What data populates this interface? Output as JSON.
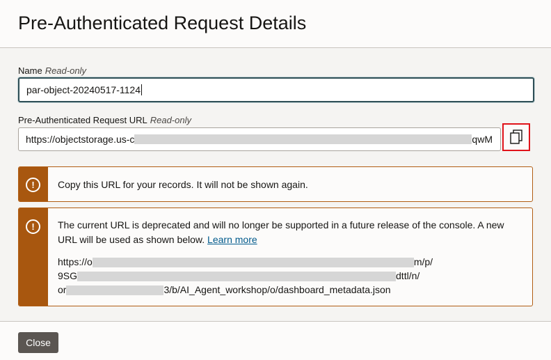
{
  "dialog": {
    "title": "Pre-Authenticated Request Details"
  },
  "name_field": {
    "label": "Name",
    "readonly_tag": "Read-only",
    "value": "par-object-20240517-1124"
  },
  "url_field": {
    "label": "Pre-Authenticated Request URL",
    "readonly_tag": "Read-only",
    "value_visible_start": "https://objectstorage.us-c",
    "value_visible_end": "qwM"
  },
  "copy_button": {
    "icon": "copy-icon"
  },
  "notice_copy": {
    "icon": "info-icon",
    "text": "Copy this URL for your records. It will not be shown again."
  },
  "notice_deprecated": {
    "icon": "info-icon",
    "text": "The current URL is deprecated and will no longer be supported in a future release of the console. A new URL will be used as shown below.",
    "link_label": "Learn more",
    "url_line1_start": "https://o",
    "url_line1_end": "m/p/",
    "url_line2_start": "9SG",
    "url_line2_end": "dttl/n/",
    "url_line3_start": "or",
    "url_line3_end": "3/b/AI_Agent_workshop/o/dashboard_metadata.json"
  },
  "footer": {
    "close_label": "Close"
  },
  "colors": {
    "warning_bar": "#a8570f",
    "highlight_box": "#e0131a",
    "link": "#005a8c",
    "close_button": "#5b5652"
  }
}
